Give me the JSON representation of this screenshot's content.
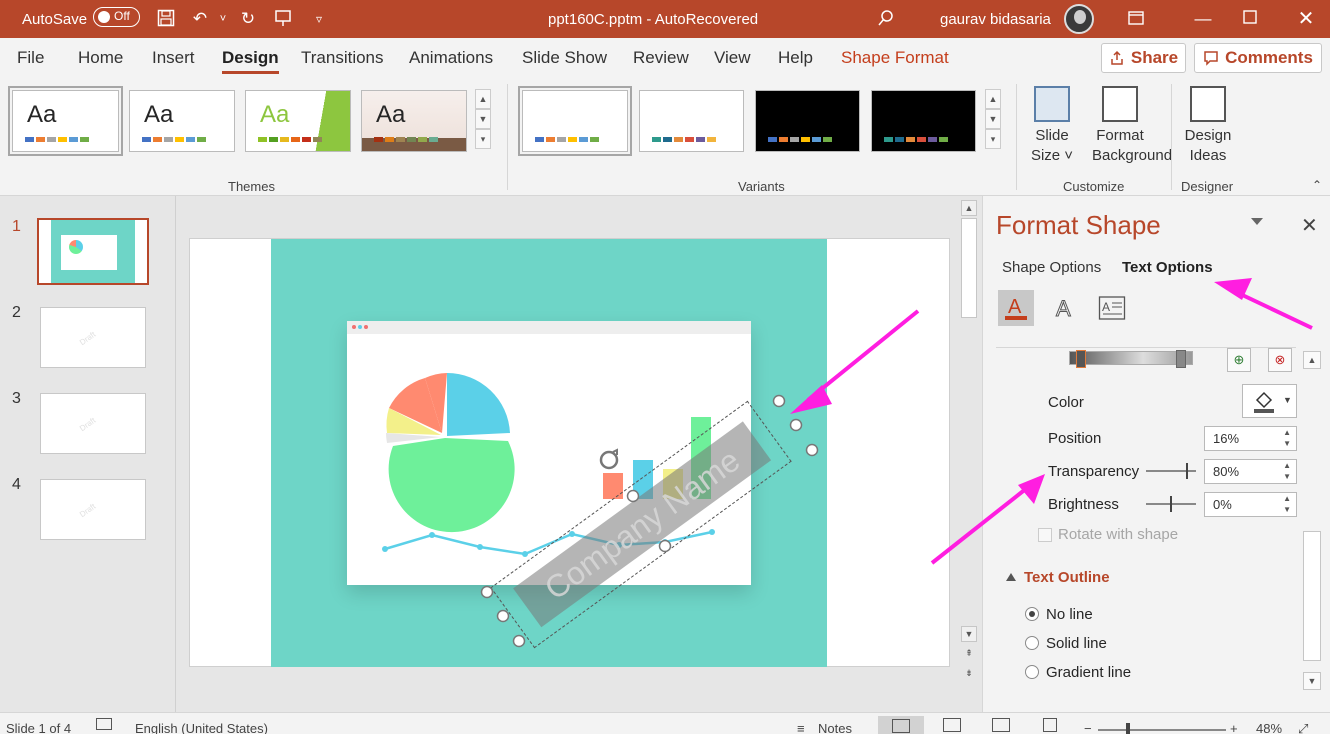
{
  "titlebar": {
    "autosave_label": "AutoSave",
    "autosave_state": "Off",
    "document_title": "ppt160C.pptm  -  AutoRecovered",
    "user_name": "gaurav bidasaria"
  },
  "menu": {
    "tabs": [
      "File",
      "Home",
      "Insert",
      "Design",
      "Transitions",
      "Animations",
      "Slide Show",
      "Review",
      "View",
      "Help",
      "Shape Format"
    ],
    "active_tab": "Design",
    "share_label": "Share",
    "comments_label": "Comments"
  },
  "ribbon": {
    "themes_label": "Themes",
    "variants_label": "Variants",
    "customize_label": "Customize",
    "designer_label": "Designer",
    "theme_thumb_text": "Aa",
    "slide_size_label_1": "Slide",
    "slide_size_label_2": "Size ˅",
    "format_bg_label_1": "Format",
    "format_bg_label_2": "Background",
    "design_ideas_label_1": "Design",
    "design_ideas_label_2": "Ideas"
  },
  "slides": {
    "numbers": [
      "1",
      "2",
      "3",
      "4"
    ],
    "watermark": "Draft"
  },
  "canvas": {
    "watermark_text": "Company Name"
  },
  "format_pane": {
    "title": "Format Shape",
    "tab_shape": "Shape Options",
    "tab_text": "Text Options",
    "color_label": "Color",
    "position_label": "Position",
    "position_value": "16%",
    "transparency_label": "Transparency",
    "transparency_value": "80%",
    "brightness_label": "Brightness",
    "brightness_value": "0%",
    "rotate_label": "Rotate with shape",
    "text_outline_label": "Text Outline",
    "no_line": "No line",
    "solid_line": "Solid line",
    "gradient_line": "Gradient line"
  },
  "statusbar": {
    "slide_info": "Slide 1 of 4",
    "language": "English (United States)",
    "notes_label": "Notes",
    "zoom": "48%"
  },
  "colors": {
    "accent": "#b7472a",
    "teal": "#6ed5c7",
    "annotation": "#ff1ee0"
  }
}
